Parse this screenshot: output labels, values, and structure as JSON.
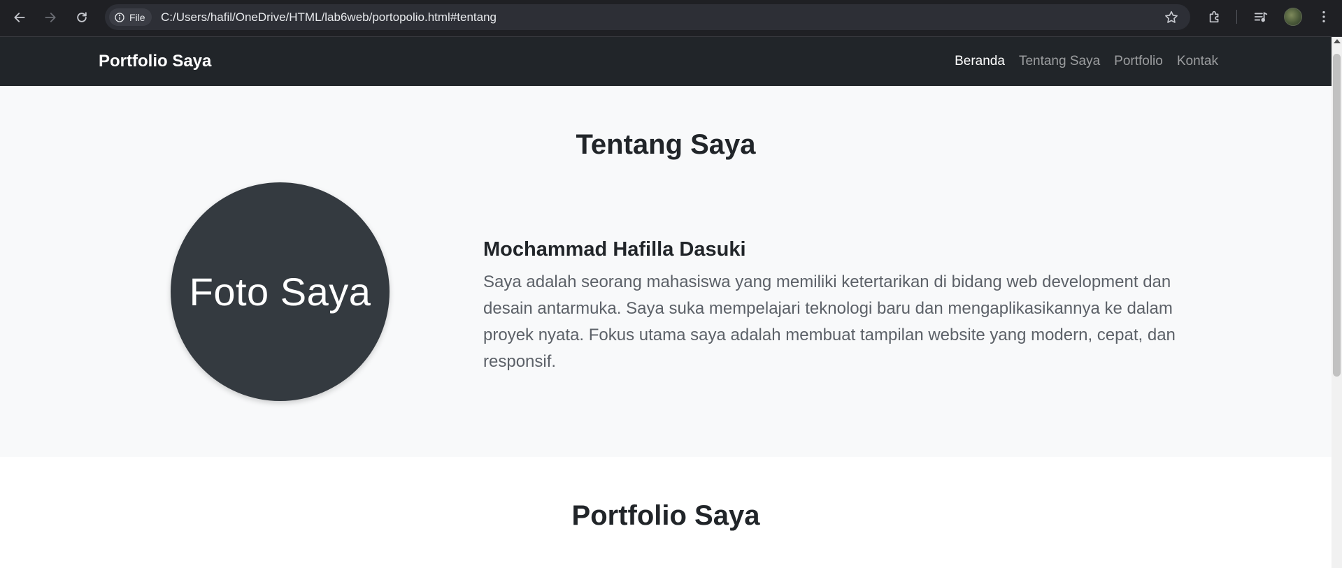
{
  "browser": {
    "site_chip_label": "File",
    "url": "C:/Users/hafil/OneDrive/HTML/lab6web/portopolio.html#tentang"
  },
  "navbar": {
    "brand": "Portfolio Saya",
    "links": [
      {
        "label": "Beranda",
        "active": true
      },
      {
        "label": "Tentang Saya",
        "active": false
      },
      {
        "label": "Portfolio",
        "active": false
      },
      {
        "label": "Kontak",
        "active": false
      }
    ]
  },
  "about": {
    "title": "Tentang Saya",
    "photo_label": "Foto Saya",
    "name": "Mochammad Hafilla Dasuki",
    "description": "Saya adalah seorang mahasiswa yang memiliki ketertarikan di bidang web development dan desain antarmuka. Saya suka mempelajari teknologi baru dan mengaplikasikannya ke dalam proyek nyata. Fokus utama saya adalah membuat tampilan website yang modern, cepat, dan responsif."
  },
  "portfolio": {
    "title": "Portfolio Saya"
  },
  "colors": {
    "navbar_bg": "#212529",
    "about_bg": "#f8f9fa",
    "photo_bg": "#343a40",
    "browser_bg": "#1f2024"
  }
}
